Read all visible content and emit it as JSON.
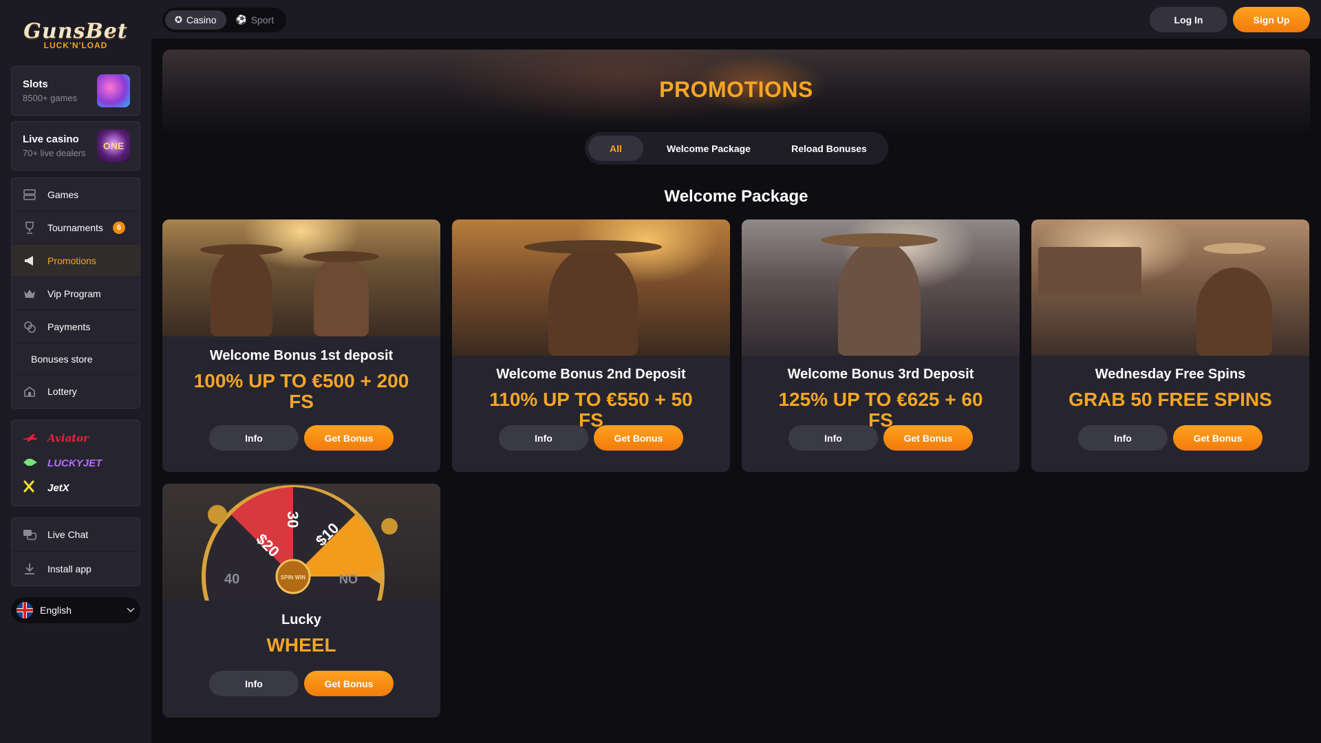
{
  "brand": {
    "name": "GunsBet",
    "tagline": "LUCK'N'LOAD"
  },
  "header": {
    "tabs": [
      {
        "label": "Casino",
        "active": true
      },
      {
        "label": "Sport",
        "active": false
      }
    ],
    "login_label": "Log In",
    "signup_label": "Sign Up"
  },
  "sidebar": {
    "categories": [
      {
        "title": "Slots",
        "subtitle": "8500+ games"
      },
      {
        "title": "Live casino",
        "subtitle": "70+ live dealers",
        "thumb_text": "ONE"
      }
    ],
    "nav": [
      {
        "label": "Games",
        "icon": "games-icon"
      },
      {
        "label": "Tournaments",
        "icon": "trophy-icon",
        "badge": "6"
      },
      {
        "label": "Promotions",
        "icon": "megaphone-icon",
        "active": true
      },
      {
        "label": "Vip Program",
        "icon": "vip-icon"
      },
      {
        "label": "Payments",
        "icon": "coins-icon"
      },
      {
        "label": "Bonuses store",
        "icon": ""
      },
      {
        "label": "Lottery",
        "icon": "lottery-icon"
      }
    ],
    "crash_games": [
      {
        "label": "Aviator",
        "icon": "plane-icon"
      },
      {
        "label": "LUCKYJET",
        "icon": "jet-icon"
      },
      {
        "label": "JetX",
        "icon": "x-icon"
      }
    ],
    "support": [
      {
        "label": "Live Chat",
        "icon": "chat-icon"
      },
      {
        "label": "Install app",
        "icon": "download-icon"
      }
    ],
    "language": "English"
  },
  "main": {
    "page_title": "PROMOTIONS",
    "filters": [
      {
        "label": "All",
        "active": true
      },
      {
        "label": "Welcome Package",
        "active": false
      },
      {
        "label": "Reload Bonuses",
        "active": false
      }
    ],
    "section_title": "Welcome Package",
    "cards": [
      {
        "title": "Welcome Bonus 1st deposit",
        "value": "100% UP TO €500 + 200 FS",
        "info_label": "Info",
        "get_label": "Get Bonus"
      },
      {
        "title": "Welcome Bonus 2nd Deposit",
        "value": "110% UP TO €550 + 50 FS",
        "info_label": "Info",
        "get_label": "Get Bonus"
      },
      {
        "title": "Welcome Bonus 3rd Deposit",
        "value": "125% UP TO €625 + 60 FS",
        "info_label": "Info",
        "get_label": "Get Bonus"
      },
      {
        "title": "Wednesday Free Spins",
        "value": "GRAB 50 FREE SPINS",
        "info_label": "Info",
        "get_label": "Get Bonus"
      },
      {
        "title": "Lucky",
        "value": "WHEEL",
        "info_label": "Info",
        "get_label": "Get Bonus",
        "wheel_labels": [
          "$20",
          "30",
          "$10",
          "40",
          "NO",
          "SPIN WIN"
        ]
      }
    ]
  },
  "colors": {
    "accent": "#f5a623",
    "button_gradient_start": "#ffa21d",
    "button_gradient_end": "#f27b0b",
    "sidebar_bg": "#1c1b24",
    "card_bg": "#26252f"
  }
}
